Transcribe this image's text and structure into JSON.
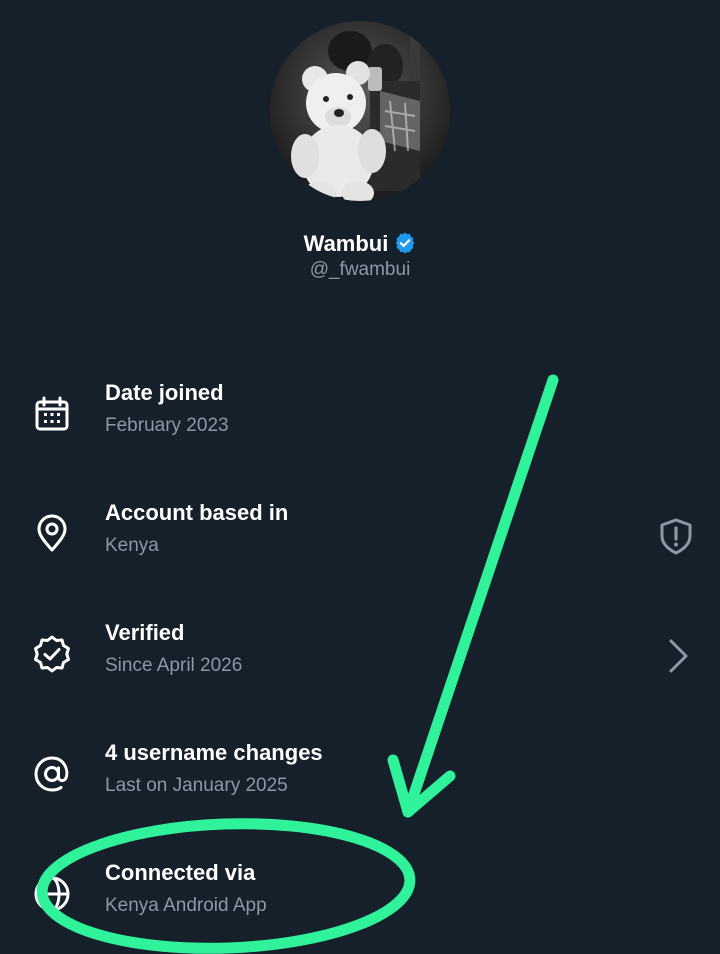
{
  "profile": {
    "name": "Wambui",
    "handle": "@_fwambui",
    "verified_badge_icon": "verified-badge-icon",
    "badge_color": "#1d9bf0"
  },
  "info_rows": [
    {
      "title": "Date joined",
      "subtitle": "February 2023",
      "icon": "calendar-icon"
    },
    {
      "title": "Account based in",
      "subtitle": "Kenya",
      "icon": "location-pin-icon",
      "right_icon": "shield-alert-icon"
    },
    {
      "title": "Verified",
      "subtitle": "Since April 2026",
      "icon": "verified-seal-icon",
      "right_icon": "chevron-right-icon"
    },
    {
      "title": "4 username changes",
      "subtitle": "Last on January 2025",
      "icon": "at-sign-icon"
    },
    {
      "title": "Connected via",
      "subtitle": "Kenya Android App",
      "icon": "globe-icon"
    }
  ],
  "colors": {
    "background": "#15202b",
    "primary_text": "#ffffff",
    "secondary_text": "#8b98a5",
    "annotation": "#2ff29a"
  }
}
